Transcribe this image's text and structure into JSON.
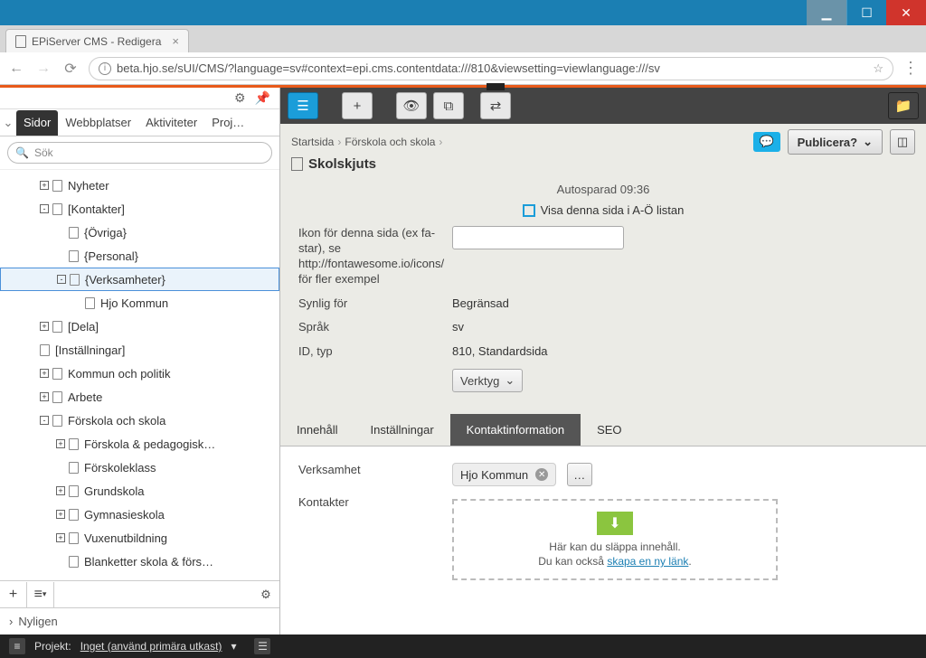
{
  "window": {
    "title": "EPiServer CMS - Redigera"
  },
  "browser": {
    "url": "beta.hjo.se/sUI/CMS/?language=sv#context=epi.cms.contentdata:///810&viewsetting=viewlanguage:///sv"
  },
  "left_panel": {
    "tabs": [
      "Sidor",
      "Webbplatser",
      "Aktiviteter",
      "Proj…"
    ],
    "active_tab": 0,
    "search_placeholder": "Sök",
    "tree": [
      {
        "label": "Nyheter",
        "depth": 1,
        "toggle": "+"
      },
      {
        "label": "[Kontakter]",
        "depth": 1,
        "toggle": "-"
      },
      {
        "label": "{Övriga}",
        "depth": 2,
        "toggle": null
      },
      {
        "label": "{Personal}",
        "depth": 2,
        "toggle": null
      },
      {
        "label": "{Verksamheter}",
        "depth": 2,
        "toggle": "-",
        "selected": true
      },
      {
        "label": "Hjo Kommun",
        "depth": 3,
        "toggle": null
      },
      {
        "label": "[Dela]",
        "depth": 1,
        "toggle": "+"
      },
      {
        "label": "[Inställningar]",
        "depth": 1,
        "toggle": null
      },
      {
        "label": "Kommun och politik",
        "depth": 1,
        "toggle": "+"
      },
      {
        "label": "Arbete",
        "depth": 1,
        "toggle": "+"
      },
      {
        "label": "Förskola och skola",
        "depth": 1,
        "toggle": "-"
      },
      {
        "label": "Förskola & pedagogisk…",
        "depth": 2,
        "toggle": "+"
      },
      {
        "label": "Förskoleklass",
        "depth": 2,
        "toggle": null
      },
      {
        "label": "Grundskola",
        "depth": 2,
        "toggle": "+"
      },
      {
        "label": "Gymnasieskola",
        "depth": 2,
        "toggle": "+"
      },
      {
        "label": "Vuxenutbildning",
        "depth": 2,
        "toggle": "+"
      },
      {
        "label": "Blanketter skola & förs…",
        "depth": 2,
        "toggle": null
      }
    ],
    "recent_label": "Nyligen"
  },
  "breadcrumb": [
    "Startsida",
    "Förskola och skola"
  ],
  "page_title": "Skolskjuts",
  "publish_label": "Publicera?",
  "autosave": "Autosparad 09:36",
  "form": {
    "checkbox_label": "Visa denna sida i A-Ö listan",
    "icon_label": "Ikon för denna sida (ex fa-star), se http://fontawesome.io/icons/ för fler exempel",
    "visible_label": "Synlig för",
    "visible_value": "Begränsad",
    "language_label": "Språk",
    "language_value": "sv",
    "id_label": "ID, typ",
    "id_value": "810, Standardsida",
    "tools_label": "Verktyg"
  },
  "edit_tabs": [
    "Innehåll",
    "Inställningar",
    "Kontaktinformation",
    "SEO"
  ],
  "edit_active": 2,
  "contact": {
    "verksamhet_label": "Verksamhet",
    "verksamhet_value": "Hjo Kommun",
    "kontakter_label": "Kontakter",
    "drop_text1": "Här kan du släppa innehåll.",
    "drop_text2a": "Du kan också ",
    "drop_link": "skapa en ny länk",
    "drop_text2b": "."
  },
  "footer": {
    "project_label": "Projekt:",
    "project_value": "Inget (använd primära utkast)"
  }
}
